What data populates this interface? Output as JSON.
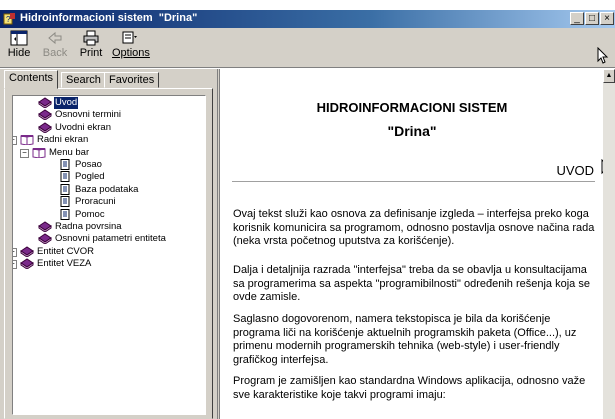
{
  "window": {
    "title": "Hidroinformacioni sistem  \"Drina\"",
    "min_label": "_",
    "max_label": "□",
    "close_label": "×"
  },
  "toolbar": {
    "hide": "Hide",
    "back": "Back",
    "print": "Print",
    "options": "Options"
  },
  "tabs": [
    "Contents",
    "Search",
    "Favorites"
  ],
  "tree": [
    {
      "label": "Uvod",
      "icon": "book-closed-icon",
      "selected": true
    },
    {
      "label": "Osnovni termini",
      "icon": "book-closed-icon"
    },
    {
      "label": "Uvodni ekran",
      "icon": "book-closed-icon"
    },
    {
      "label": "Radni ekran",
      "icon": "book-open-icon",
      "expander": "−"
    },
    {
      "label": "Menu bar",
      "icon": "book-open-icon",
      "expander": "−"
    },
    {
      "label": "Posao",
      "icon": "page-icon"
    },
    {
      "label": "Pogled",
      "icon": "page-icon"
    },
    {
      "label": "Baza podataka",
      "icon": "page-icon"
    },
    {
      "label": "Proracuni",
      "icon": "page-icon"
    },
    {
      "label": "Pomoc",
      "icon": "page-icon"
    },
    {
      "label": "Radna povrsina",
      "icon": "book-closed-icon"
    },
    {
      "label": "Osnovni patametri entiteta",
      "icon": "book-closed-icon"
    },
    {
      "label": "Entitet CVOR",
      "icon": "book-closed-icon",
      "expander": "+"
    },
    {
      "label": "Entitet VEZA",
      "icon": "book-closed-icon",
      "expander": "+"
    }
  ],
  "content": {
    "heading": "HIDROINFORMACIONI SISTEM",
    "subheading": "\"Drina\"",
    "section": "UVOD",
    "paragraphs": [
      "Ovaj tekst služi kao osnova za definisanje izgleda – interfejsa preko koga korisnik komunicira sa programom, odnosno postavlja osnove načina rada (neka vrsta početnog uputstva za korišćenje).",
      "Dalja i detaljnija razrada \"interfejsa\" treba da se obavlja u konsultacijama sa programerima sa aspekta \"programibilnosti\" određenih rešenja koja se ovde zamisle.",
      "Saglasno dogovorenom, namera tekstopisca je bila da korišćenje programa liči na korišćenje aktuelnih programskih paketa (Office...), uz primenu modernih programerskih tehnika (web-style) i user-friendly grafičkog interfejsa.",
      "Program je zamišljen kao standardna Windows aplikacija, odnosno važe sve karakteristike koje takvi programi imaju:"
    ]
  }
}
